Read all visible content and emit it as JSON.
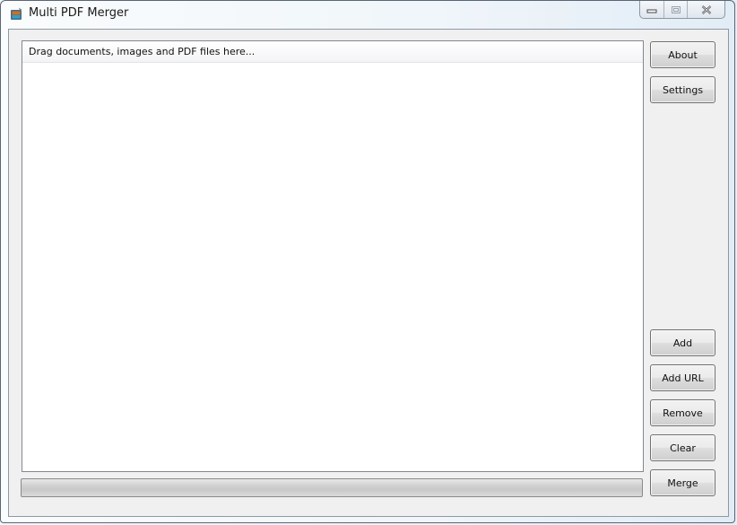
{
  "window": {
    "title": "Multi PDF Merger",
    "icon": "app-icon",
    "caption_buttons": [
      "minimize",
      "maximize",
      "close"
    ]
  },
  "list": {
    "header": "Drag documents, images and PDF files here...",
    "items": []
  },
  "progress": {
    "value": 0
  },
  "buttons": {
    "about": "About",
    "settings": "Settings",
    "add": "Add",
    "add_url": "Add URL",
    "remove": "Remove",
    "clear": "Clear",
    "merge": "Merge"
  }
}
